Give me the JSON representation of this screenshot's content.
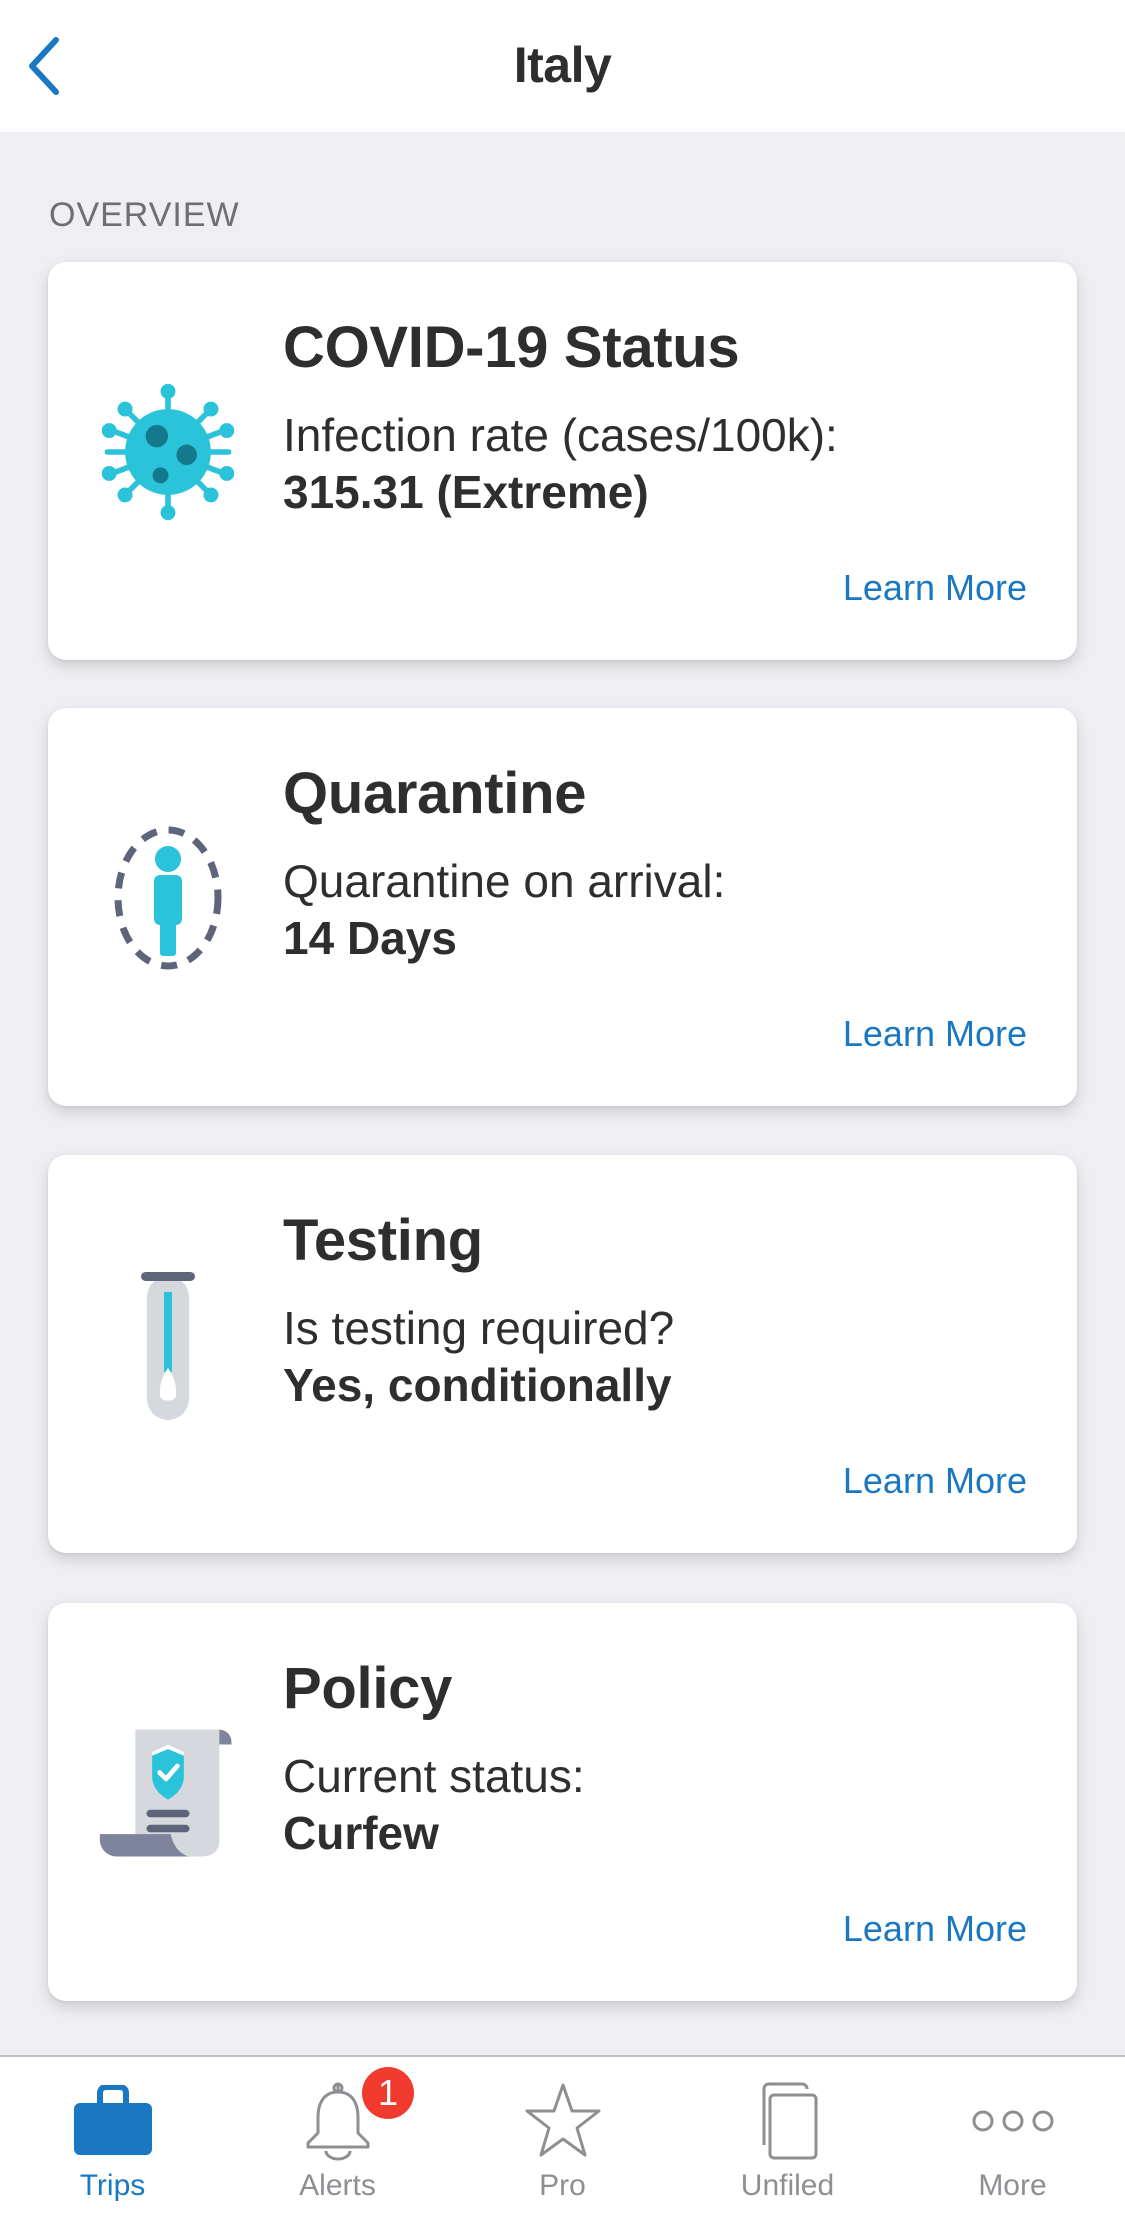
{
  "header": {
    "title": "Italy",
    "back_icon": "chevron-left-icon"
  },
  "section": {
    "label": "OVERVIEW"
  },
  "cards": [
    {
      "id": "covid-status",
      "icon": "virus-icon",
      "title": "COVID-19 Status",
      "label": "Infection rate (cases/100k):",
      "value": "315.31 (Extreme)",
      "link": "Learn More"
    },
    {
      "id": "quarantine",
      "icon": "person-quarantine-icon",
      "title": "Quarantine",
      "label": "Quarantine on arrival:",
      "value": "14 Days",
      "link": "Learn More"
    },
    {
      "id": "testing",
      "icon": "test-tube-swab-icon",
      "title": "Testing",
      "label": "Is testing required?",
      "value": "Yes, conditionally",
      "link": "Learn More"
    },
    {
      "id": "policy",
      "icon": "policy-scroll-shield-icon",
      "title": "Policy",
      "label": "Current status:",
      "value": "Curfew",
      "link": "Learn More"
    }
  ],
  "tab_bar": {
    "tabs": [
      {
        "label": "Trips",
        "icon": "briefcase-icon",
        "active": true
      },
      {
        "label": "Alerts",
        "icon": "bell-icon",
        "active": false,
        "badge": "1"
      },
      {
        "label": "Pro",
        "icon": "star-icon",
        "active": false
      },
      {
        "label": "Unfiled",
        "icon": "documents-icon",
        "active": false
      },
      {
        "label": "More",
        "icon": "more-dots-icon",
        "active": false
      }
    ]
  },
  "colors": {
    "accent": "#1A78C2",
    "icon_teal": "#2BC3DA",
    "icon_slate": "#5E6479",
    "badge_red": "#F03A2E",
    "background": "#EEEEF3",
    "text": "#2E2E30",
    "inactive_tab": "#8E8E93"
  }
}
